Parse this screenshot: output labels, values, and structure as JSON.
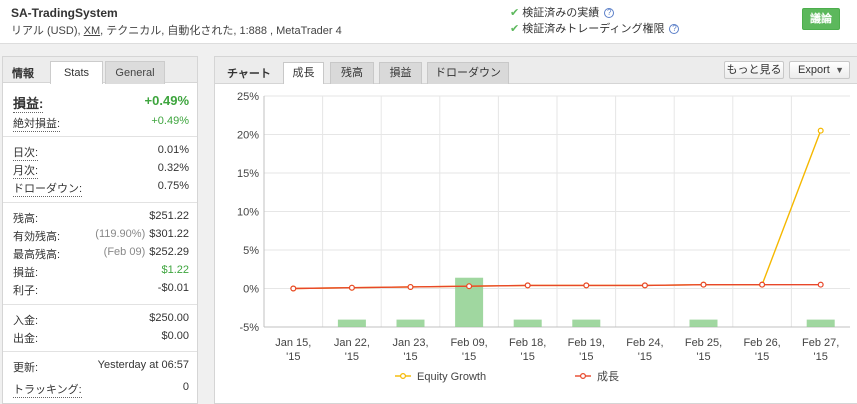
{
  "header": {
    "title": "SA-TradingSystem",
    "meta_prefix": "リアル (USD), ",
    "broker": "XM",
    "meta_suffix": ", テクニカル, 自動化された, 1:888 , MetaTrader 4",
    "verified_track_record": "検証済みの実績",
    "verified_trading_privileges": "検証済みトレーディング権限",
    "help_glyph": "?",
    "check_icon": "check-icon",
    "discuss_label": "議論",
    "accent_color": "#5cb85c"
  },
  "info": {
    "section_label": "情報",
    "tabs": {
      "stats": "Stats",
      "general": "General"
    },
    "gain_label": "損益:",
    "gain_value": "+0.49%",
    "abs_gain_label": "絶対損益:",
    "abs_gain_value": "+0.49%",
    "daily_label": "日次:",
    "daily_value": "0.01%",
    "monthly_label": "月次:",
    "monthly_value": "0.32%",
    "drawdown_label": "ドローダウン:",
    "drawdown_value": "0.75%",
    "balance_label": "残高:",
    "balance_value": "$251.22",
    "equity_label": "有効残高:",
    "equity_note": "(119.90%)",
    "equity_value": "$301.22",
    "highest_label": "最高残高:",
    "highest_note": "(Feb 09)",
    "highest_value": "$252.29",
    "profit_label": "損益:",
    "profit_value": "$1.22",
    "interest_label": "利子:",
    "interest_value": "-$0.01",
    "deposits_label": "入金:",
    "deposits_value": "$250.00",
    "withdrawals_label": "出金:",
    "withdrawals_value": "$0.00",
    "updated_label": "更新:",
    "updated_value": "Yesterday at 06:57",
    "tracking_label": "トラッキング:",
    "tracking_value": "0"
  },
  "chart_panel": {
    "section_label": "チャート",
    "tabs": {
      "growth": "成長",
      "balance": "残高",
      "profit": "損益",
      "drawdown": "ドローダウン"
    },
    "more_label": "もっと見る",
    "export_label": "Export",
    "export_caret": "▼"
  },
  "chart_data": {
    "type": "line",
    "categories": [
      [
        "Jan 15,",
        "'15"
      ],
      [
        "Jan 22,",
        "'15"
      ],
      [
        "Jan 23,",
        "'15"
      ],
      [
        "Feb 09,",
        "'15"
      ],
      [
        "Feb 18,",
        "'15"
      ],
      [
        "Feb 19,",
        "'15"
      ],
      [
        "Feb 24,",
        "'15"
      ],
      [
        "Feb 25,",
        "'15"
      ],
      [
        "Feb 26,",
        "'15"
      ],
      [
        "Feb 27,",
        "'15"
      ]
    ],
    "y_ticks": [
      "25%",
      "20%",
      "15%",
      "10%",
      "5%",
      "0%",
      "-5%"
    ],
    "ylim": [
      -5,
      25
    ],
    "series": [
      {
        "name": "Equity Growth",
        "color": "#f5b800",
        "values": [
          0,
          0.1,
          0.2,
          0.3,
          0.4,
          0.4,
          0.4,
          0.5,
          0.5,
          20.5
        ]
      },
      {
        "name": "成長",
        "color": "#e8472a",
        "values": [
          0,
          0.1,
          0.2,
          0.3,
          0.4,
          0.4,
          0.4,
          0.5,
          0.5,
          0.5
        ]
      }
    ],
    "bars": {
      "color": "#8fd08f",
      "values": [
        0,
        -0.3,
        -0.3,
        -2,
        -0.3,
        -0.3,
        0,
        -0.3,
        0,
        -0.3
      ]
    },
    "grid": true,
    "legend_position": "bottom"
  }
}
